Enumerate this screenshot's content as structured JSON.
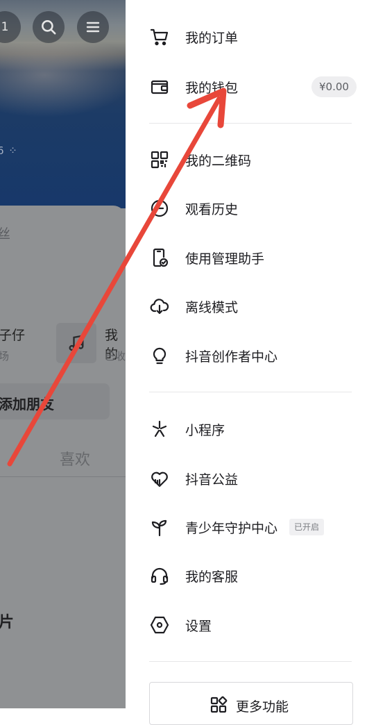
{
  "background_page": {
    "friends_button": "1",
    "cover_id_text": "6 ⁘",
    "fans_text": "丝",
    "featured": {
      "title": "子仔",
      "subtitle": "场"
    },
    "music": {
      "title": "我的",
      "subtitle": "已收"
    },
    "add_friend_label": "添加朋友",
    "likes_tab": "喜欢",
    "photo_text": "片"
  },
  "side_menu": {
    "group1": [
      {
        "label": "我的订单",
        "icon": "cart-icon"
      },
      {
        "label": "我的钱包",
        "icon": "wallet-icon",
        "balance": "¥0.00"
      }
    ],
    "group2": [
      {
        "label": "我的二维码",
        "icon": "qr-code-icon"
      },
      {
        "label": "观看历史",
        "icon": "history-icon"
      },
      {
        "label": "使用管理助手",
        "icon": "phone-check-icon"
      },
      {
        "label": "离线模式",
        "icon": "cloud-download-icon"
      },
      {
        "label": "抖音创作者中心",
        "icon": "lightbulb-icon"
      }
    ],
    "group3": [
      {
        "label": "小程序",
        "icon": "mini-program-icon"
      },
      {
        "label": "抖音公益",
        "icon": "charity-heart-icon"
      },
      {
        "label": "青少年守护中心",
        "icon": "sprout-icon",
        "tag": "已开启"
      },
      {
        "label": "我的客服",
        "icon": "headset-icon"
      },
      {
        "label": "设置",
        "icon": "settings-hexagon-icon"
      }
    ],
    "more_label": "更多功能"
  },
  "colors": {
    "annotation_arrow": "#e8473a",
    "overlay": "#8f9194"
  }
}
